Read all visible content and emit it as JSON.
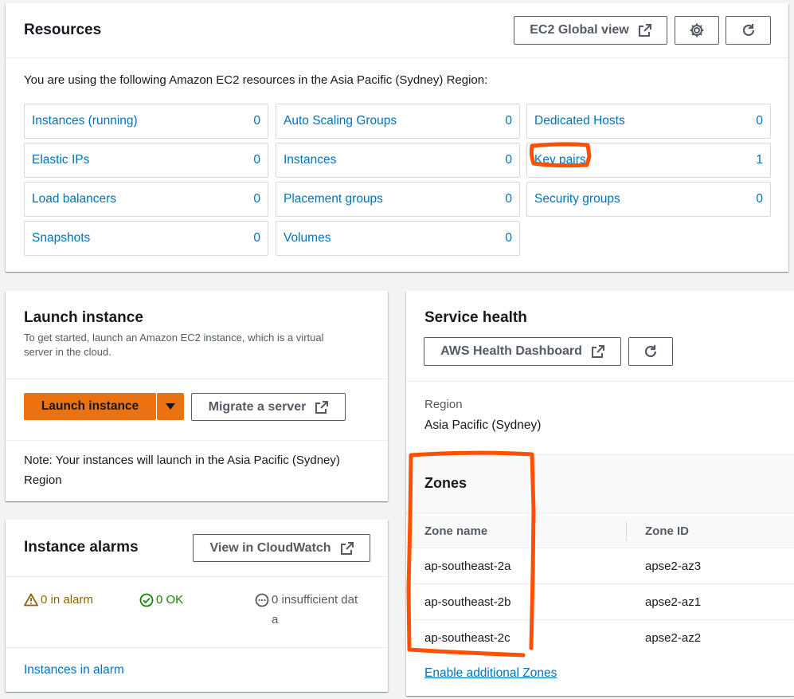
{
  "resources": {
    "title": "Resources",
    "global_view_label": "EC2 Global view",
    "settings_icon": "gear-icon",
    "refresh_icon": "refresh-icon",
    "intro": "You are using the following Amazon EC2 resources in the Asia Pacific (Sydney) Region:",
    "tiles": [
      {
        "label": "Instances (running)",
        "count": "0"
      },
      {
        "label": "Auto Scaling Groups",
        "count": "0"
      },
      {
        "label": "Dedicated Hosts",
        "count": "0"
      },
      {
        "label": "Elastic IPs",
        "count": "0"
      },
      {
        "label": "Instances",
        "count": "0"
      },
      {
        "label": "Key pairs",
        "count": "1"
      },
      {
        "label": "Load balancers",
        "count": "0"
      },
      {
        "label": "Placement groups",
        "count": "0"
      },
      {
        "label": "Security groups",
        "count": "0"
      },
      {
        "label": "Snapshots",
        "count": "0"
      },
      {
        "label": "Volumes",
        "count": "0"
      }
    ]
  },
  "launch": {
    "title": "Launch instance",
    "description": "To get started, launch an Amazon EC2 instance, which is a virtual server in the cloud.",
    "launch_label": "Launch instance",
    "migrate_label": "Migrate a server",
    "note": "Note: Your instances will launch in the Asia Pacific (Sydney) Region"
  },
  "alarms": {
    "title": "Instance alarms",
    "cloudwatch_label": "View in CloudWatch",
    "in_alarm": "0 in alarm",
    "ok": "0 OK",
    "insufficient_line1": "0 insufficient dat",
    "insufficient_line2": "a",
    "link": "Instances in alarm"
  },
  "health": {
    "title": "Service health",
    "dashboard_label": "AWS Health Dashboard",
    "region_label": "Region",
    "region_value": "Asia Pacific (Sydney)",
    "zones_title": "Zones",
    "columns": [
      "Zone name",
      "Zone ID"
    ],
    "zones": [
      {
        "name": "ap-southeast-2a",
        "id": "apse2-az3"
      },
      {
        "name": "ap-southeast-2b",
        "id": "apse2-az1"
      },
      {
        "name": "ap-southeast-2c",
        "id": "apse2-az2"
      }
    ],
    "enable_link": "Enable additional Zones"
  },
  "colors": {
    "link": "#0073bb",
    "primary": "#ec7211",
    "annotation": "#ff4f00",
    "success": "#1d8102",
    "warning": "#8d6605"
  }
}
